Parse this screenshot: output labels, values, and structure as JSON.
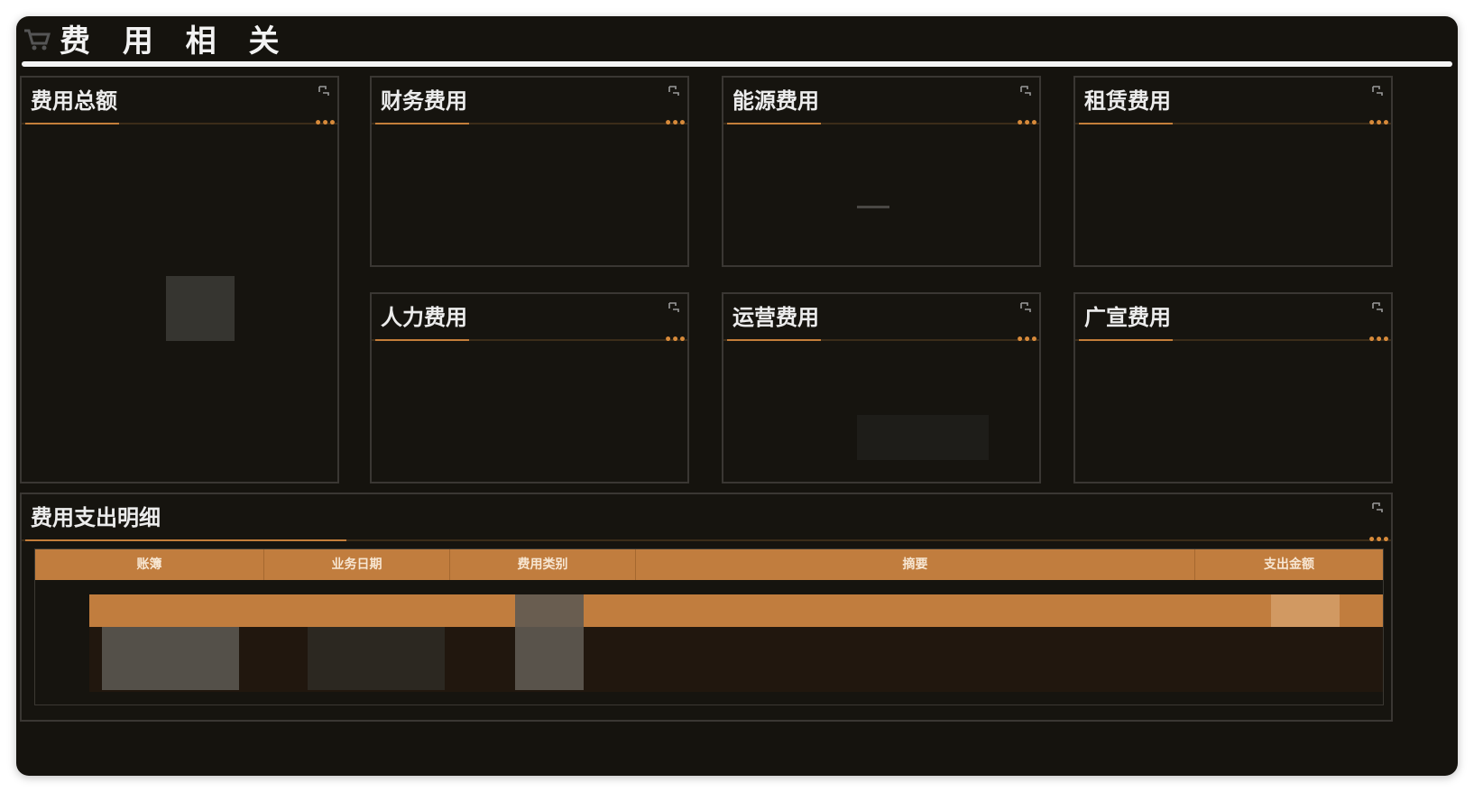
{
  "header": {
    "title": "费 用 相 关",
    "icon": "cart-icon"
  },
  "panels": {
    "total": {
      "title": "费用总额"
    },
    "finance": {
      "title": "财务费用"
    },
    "energy": {
      "title": "能源费用"
    },
    "lease": {
      "title": "租赁费用"
    },
    "hr": {
      "title": "人力费用"
    },
    "ops": {
      "title": "运营费用"
    },
    "ad": {
      "title": "广宣费用"
    }
  },
  "detail": {
    "title": "费用支出明细",
    "columns": [
      "账簿",
      "业务日期",
      "费用类别",
      "摘要",
      "支出金额"
    ]
  },
  "colors": {
    "background": "#15130e",
    "accent": "#c17d3e",
    "panel_border": "#3a3733"
  }
}
